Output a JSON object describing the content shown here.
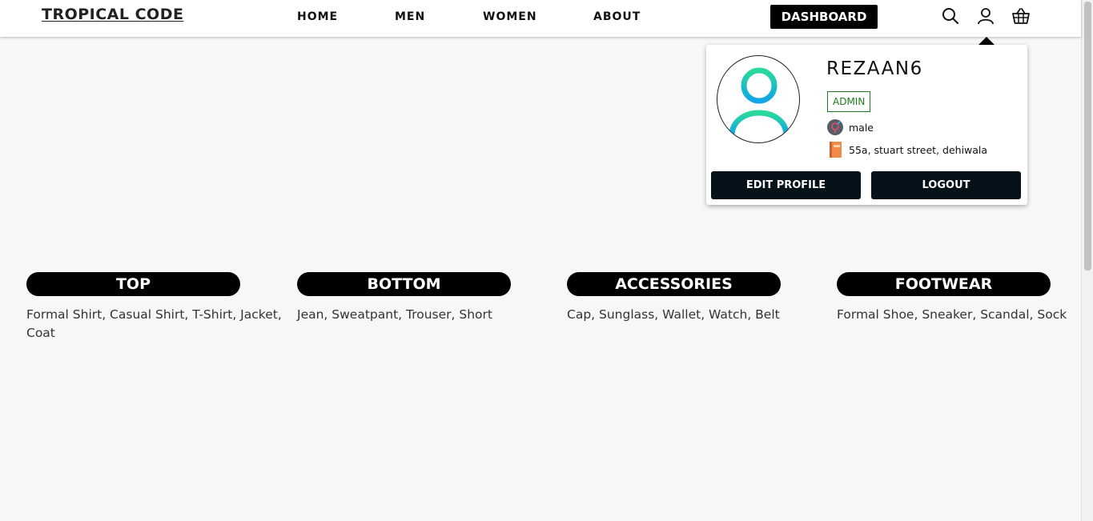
{
  "header": {
    "logo": "TROPICAL CODE",
    "nav": [
      "HOME",
      "MEN",
      "WOMEN",
      "ABOUT"
    ],
    "dashboard_label": "DASHBOARD",
    "icons": [
      "search-icon",
      "user-icon",
      "basket-icon"
    ]
  },
  "profile": {
    "username": "REZAAN6",
    "role": "ADMIN",
    "gender": "male",
    "address": "55a, stuart street, dehiwala",
    "edit_label": "EDIT PROFILE",
    "logout_label": "LOGOUT",
    "avatar_color": "#1cc7b5"
  },
  "categories": [
    {
      "title": "TOP",
      "items": "Formal Shirt, Casual Shirt, T-Shirt, Jacket, Coat"
    },
    {
      "title": "BOTTOM",
      "items": "Jean, Sweatpant, Trouser, Short"
    },
    {
      "title": "ACCESSORIES",
      "items": "Cap, Sunglass, Wallet, Watch, Belt"
    },
    {
      "title": "FOOTWEAR",
      "items": "Formal Shoe, Sneaker, Scandal, Sock"
    }
  ]
}
